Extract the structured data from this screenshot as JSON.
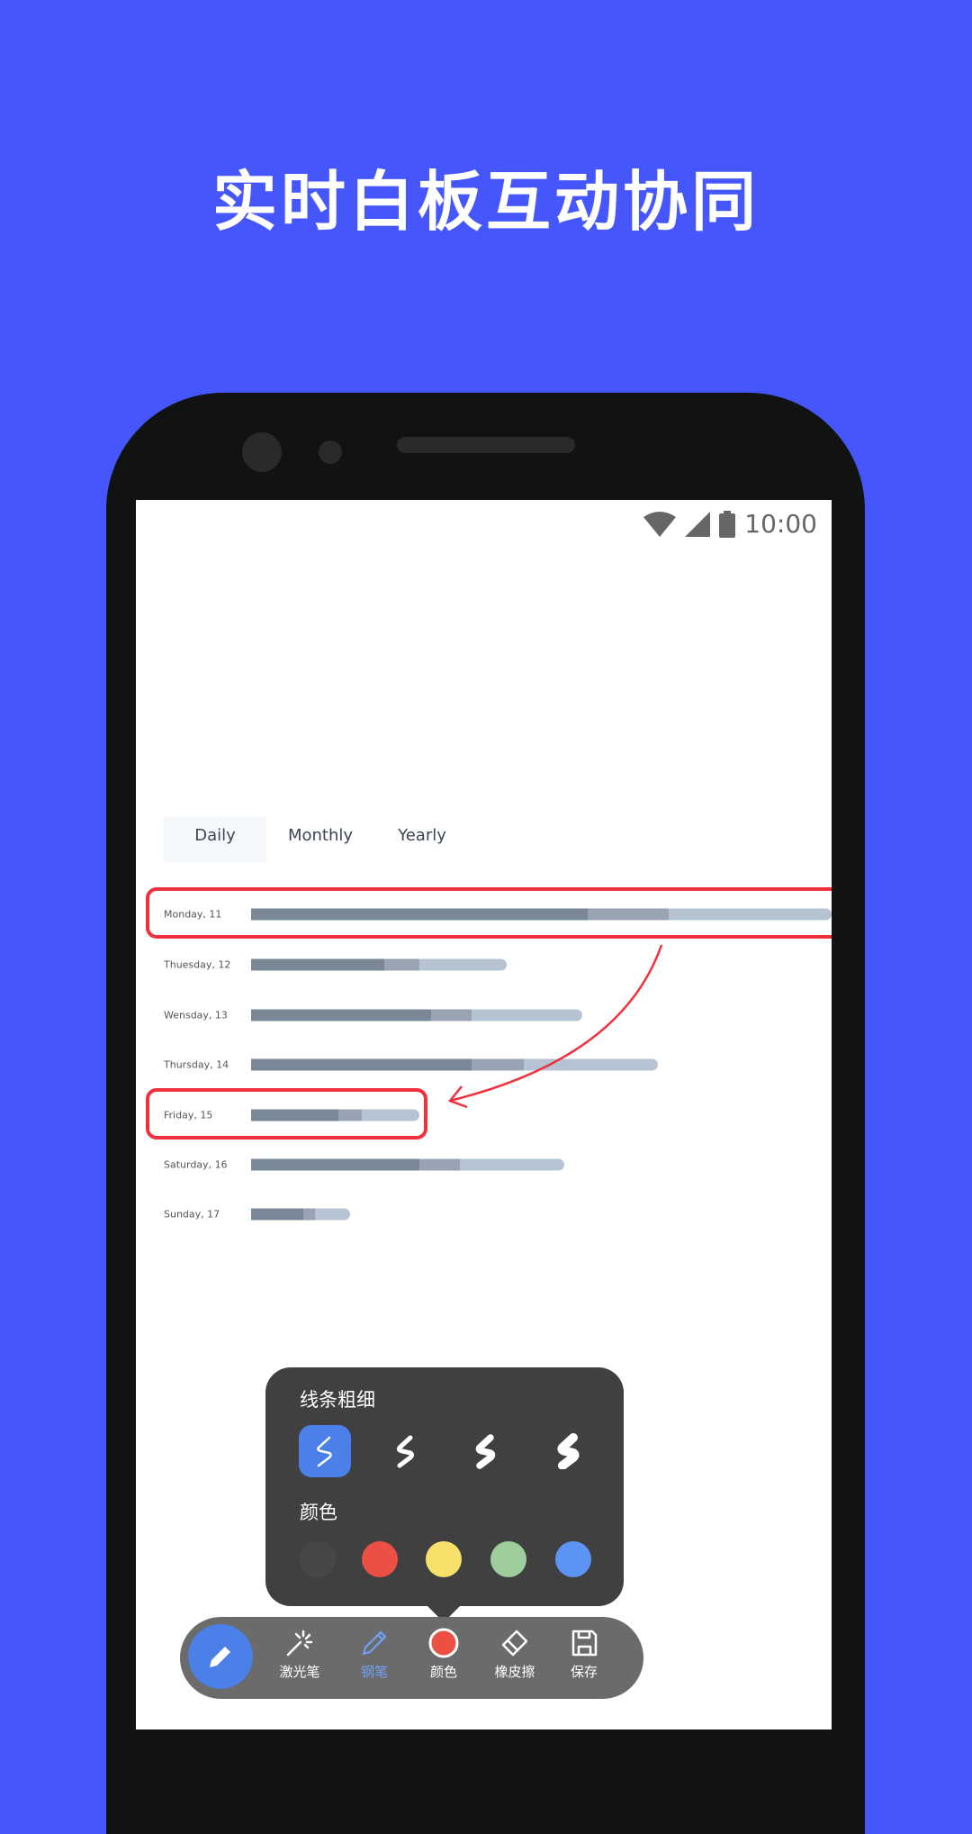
{
  "headline": "实时白板互动协同",
  "status": {
    "time": "10:00",
    "icons": [
      "wifi-icon",
      "signal-icon",
      "battery-icon"
    ]
  },
  "tabs": [
    {
      "label": "Daily",
      "selected": true
    },
    {
      "label": "Monthly"
    },
    {
      "label": "Yearly"
    }
  ],
  "rows": [
    {
      "label": "Monday, 11",
      "segments_percent": [
        58,
        72,
        100
      ],
      "highlighted": true
    },
    {
      "label": "Thuesday, 12",
      "segments_percent": [
        23,
        29,
        44
      ]
    },
    {
      "label": "Wensday, 13",
      "segments_percent": [
        31,
        38,
        57
      ]
    },
    {
      "label": "Thursday, 14",
      "segments_percent": [
        38,
        47,
        70
      ]
    },
    {
      "label": "Friday, 15",
      "segments_percent": [
        15,
        19,
        29
      ],
      "highlighted": true
    },
    {
      "label": "Saturday, 16",
      "segments_percent": [
        29,
        36,
        54
      ]
    },
    {
      "label": "Sunday, 17",
      "segments_percent": [
        9,
        11,
        17
      ]
    }
  ],
  "bar_colors": [
    "#7a8797",
    "#98a4b3",
    "#b6c3d2"
  ],
  "annotation_color": "#f0303c",
  "popup": {
    "stroke_title": "线条粗细",
    "stroke_widths": [
      1,
      2,
      3,
      4
    ],
    "selected_stroke": 0,
    "color_title": "颜色",
    "colors": [
      "#474747",
      "#ec5044",
      "#f9e06b",
      "#9fcd9b",
      "#5b94f4"
    ]
  },
  "toolbar": {
    "main_icon": "pencil-icon",
    "accent": "#4a80e8",
    "items": [
      {
        "label": "激光笔",
        "icon": "laser-pen-icon"
      },
      {
        "label": "钢笔",
        "icon": "pen-icon",
        "active": true
      },
      {
        "label": "颜色",
        "icon": "color-icon",
        "current_color": "#ec5044"
      },
      {
        "label": "橡皮擦",
        "icon": "eraser-icon"
      },
      {
        "label": "保存",
        "icon": "save-icon"
      }
    ]
  }
}
